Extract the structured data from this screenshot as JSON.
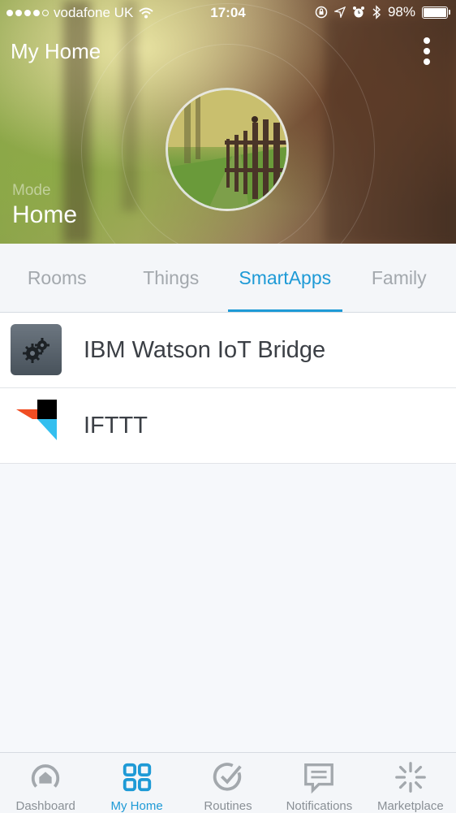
{
  "status_bar": {
    "carrier": "vodafone UK",
    "time": "17:04",
    "battery": "98%",
    "battery_level": 0.98
  },
  "header": {
    "title": "My Home",
    "mode_label": "Mode",
    "mode_value": "Home"
  },
  "tabs": [
    {
      "label": "Rooms",
      "active": false
    },
    {
      "label": "Things",
      "active": false
    },
    {
      "label": "SmartApps",
      "active": true
    },
    {
      "label": "Family",
      "active": false
    }
  ],
  "smartapps": [
    {
      "label": "IBM Watson IoT Bridge",
      "icon": "gears-icon"
    },
    {
      "label": "IFTTT",
      "icon": "ifttt-logo"
    }
  ],
  "bottom_nav": [
    {
      "label": "Dashboard",
      "icon": "dashboard-icon",
      "active": false
    },
    {
      "label": "My Home",
      "icon": "grid-icon",
      "active": true
    },
    {
      "label": "Routines",
      "icon": "check-circle-icon",
      "active": false
    },
    {
      "label": "Notifications",
      "icon": "chat-icon",
      "active": false
    },
    {
      "label": "Marketplace",
      "icon": "sparkle-icon",
      "active": false
    }
  ],
  "colors": {
    "accent": "#1e9ad6",
    "inactive": "#a3a8ad"
  }
}
